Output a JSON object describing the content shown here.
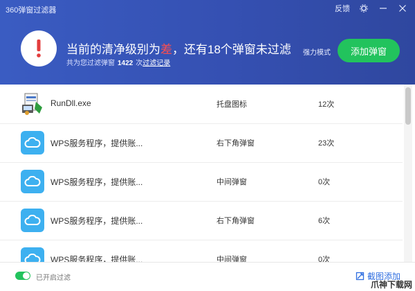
{
  "app": {
    "title": "360弹窗过滤器",
    "feedback": "反馈"
  },
  "status": {
    "headline_prefix": "当前的清净级别为",
    "level": "差",
    "headline_suffix": "，还有18个弹窗未过滤",
    "sub_prefix": "共为您过滤弹窗",
    "sub_count": "1422",
    "sub_mid": "次",
    "sub_link": "过滤记录"
  },
  "mode_label": "强力模式",
  "add_button": "添加弹窗",
  "rows": [
    {
      "name": "RunDll.exe",
      "type": "托盘图标",
      "count": "12次",
      "icon": "rundll-installer-icon"
    },
    {
      "name": "WPS服务程序，提供账...",
      "type": "右下角弹窗",
      "count": "23次",
      "icon": "cloud-icon"
    },
    {
      "name": "WPS服务程序，提供账...",
      "type": "中间弹窗",
      "count": "0次",
      "icon": "cloud-icon"
    },
    {
      "name": "WPS服务程序，提供账...",
      "type": "右下角弹窗",
      "count": "6次",
      "icon": "cloud-icon"
    },
    {
      "name": "WPS服务程序，提供账...",
      "type": "中间弹窗",
      "count": "0次",
      "icon": "cloud-icon"
    }
  ],
  "footer": {
    "toggle_label": "已开启过滤",
    "screenshot_add": "截图添加",
    "watermark": "爪神下载网"
  }
}
